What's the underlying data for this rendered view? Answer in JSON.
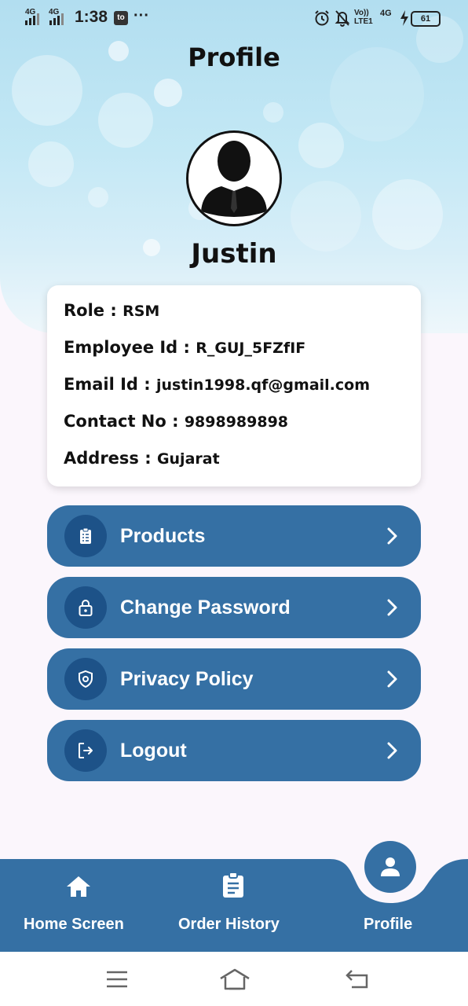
{
  "status_bar": {
    "net1": "4G",
    "net2": "4G",
    "time": "1:38",
    "app_badge": "to",
    "more": "···",
    "volte": "Vo)) LTE1",
    "net3": "4G",
    "battery": "61"
  },
  "page": {
    "title": "Profile",
    "user_name": "Justin"
  },
  "profile": {
    "role_label": "Role : ",
    "role_value": "RSM",
    "employee_label": "Employee Id : ",
    "employee_value": "R_GUJ_5FZfIF",
    "email_label": "Email Id : ",
    "email_value": "justin1998.qf@gmail.com",
    "contact_label": "Contact No : ",
    "contact_value": "9898989898",
    "address_label": "Address : ",
    "address_value": "Gujarat"
  },
  "menu": [
    {
      "label": "Products",
      "icon": "clipboard-icon"
    },
    {
      "label": "Change Password",
      "icon": "lock-icon"
    },
    {
      "label": "Privacy Policy",
      "icon": "shield-icon"
    },
    {
      "label": "Logout",
      "icon": "logout-icon"
    }
  ],
  "bottom_nav": [
    {
      "label": "Home Screen",
      "icon": "home-icon"
    },
    {
      "label": "Order History",
      "icon": "order-icon"
    },
    {
      "label": "Profile",
      "icon": "person-icon",
      "active": true
    }
  ],
  "colors": {
    "primary": "#3570a4",
    "icon_circle": "#1d5288",
    "header_top": "#b2def0",
    "background": "#fbf6fc"
  }
}
